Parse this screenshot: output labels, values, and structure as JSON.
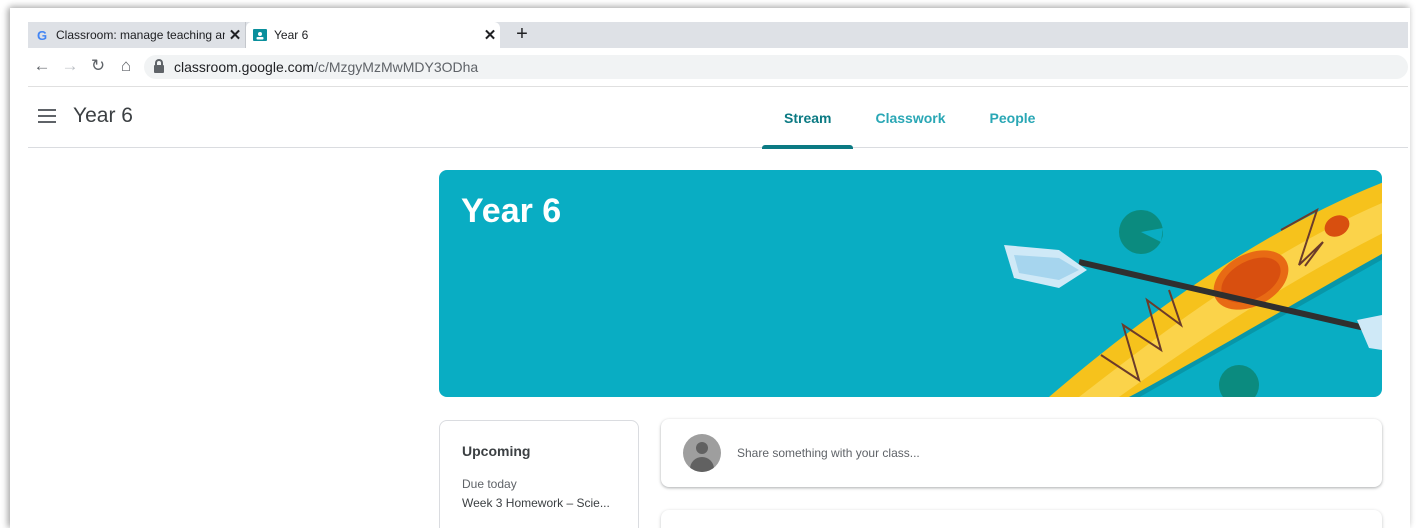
{
  "browser": {
    "tabs": [
      {
        "title": "Classroom: manage teaching and",
        "favicon": "google-g-icon",
        "active": false
      },
      {
        "title": "Year 6",
        "favicon": "classroom-icon",
        "active": true
      }
    ],
    "new_tab": "+",
    "close_glyph": "✕",
    "url_host": "classroom.google.com",
    "url_path": "/c/MzgyMzMwMDY3ODha"
  },
  "appbar": {
    "class_name": "Year 6",
    "tabs": [
      {
        "label": "Stream",
        "active": true
      },
      {
        "label": "Classwork",
        "active": false
      },
      {
        "label": "People",
        "active": false
      }
    ]
  },
  "banner": {
    "title": "Year 6",
    "background_color": "#09adc3"
  },
  "upcoming": {
    "title": "Upcoming",
    "due_label": "Due today",
    "item": "Week 3 Homework – Scie..."
  },
  "share": {
    "placeholder": "Share something with your class..."
  },
  "colors": {
    "accent": "#0b7a83",
    "tab_inactive": "#2aa7b5"
  }
}
